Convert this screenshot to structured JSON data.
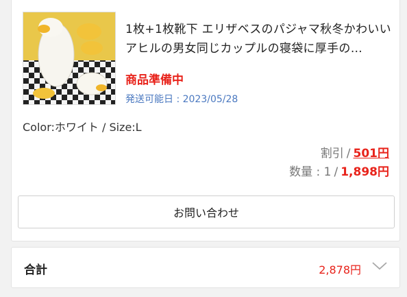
{
  "order": {
    "title": "1枚+1枚靴下 エリザベスのパジャマ秋冬かわいいアヒルの男女同じカップルの寝袋に厚手の…",
    "status": "商品準備中",
    "ship_date": "発送可能日 : 2023/05/28",
    "variant": "Color:ホワイト / Size:L",
    "discount_label": "割引",
    "discount_value": "501円",
    "quantity_label": "数量 : 1",
    "price": "1,898円",
    "contact_button": "お問い合わせ"
  },
  "total": {
    "label": "合計",
    "amount": "2,878円"
  },
  "colors": {
    "accent_red": "#e8231b",
    "link_blue": "#4a78c0"
  }
}
